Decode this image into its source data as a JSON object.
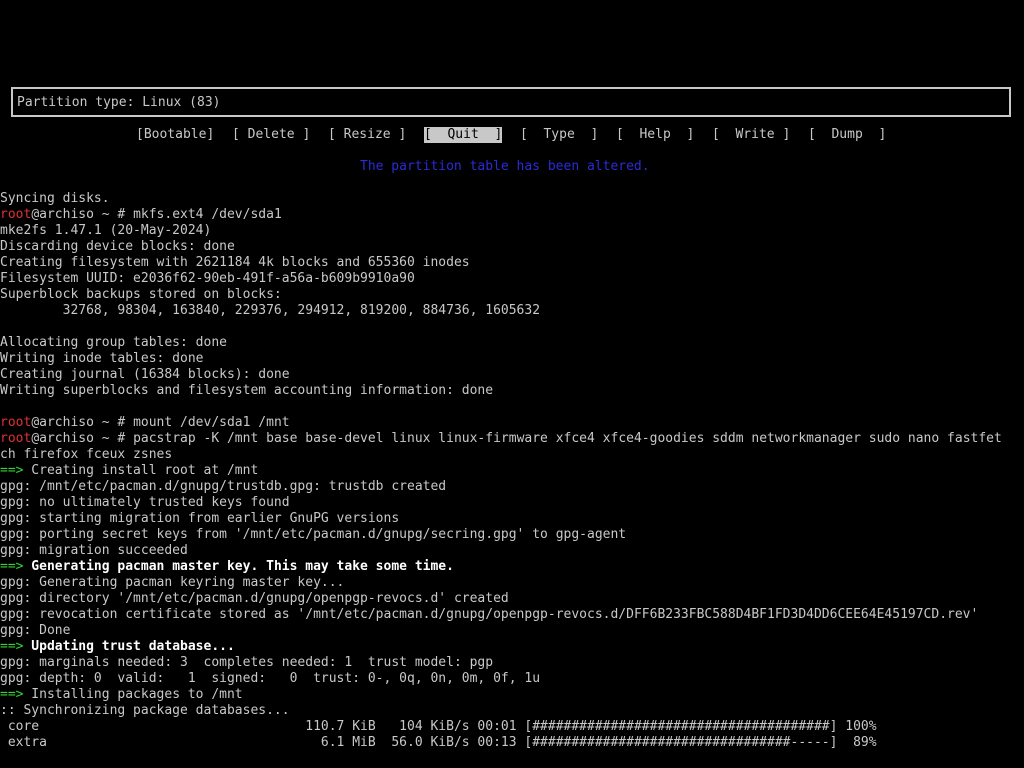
{
  "cfdisk": {
    "partition_type": "Partition type: Linux (83)",
    "menu": [
      {
        "label": "[Bootable]",
        "selected": false
      },
      {
        "label": "[ Delete ]",
        "selected": false
      },
      {
        "label": "[ Resize ]",
        "selected": false
      },
      {
        "label": "[  Quit  ]",
        "selected": true
      },
      {
        "label": "[  Type  ]",
        "selected": false
      },
      {
        "label": "[  Help  ]",
        "selected": false
      },
      {
        "label": "[  Write ]",
        "selected": false
      },
      {
        "label": "[  Dump  ]",
        "selected": false
      }
    ],
    "status": "The partition table has been altered."
  },
  "prompt": {
    "user": "root",
    "host_path": "@archiso ~ # "
  },
  "terminal": {
    "syncing": "Syncing disks.",
    "cmd_mkfs": "mkfs.ext4 /dev/sda1",
    "mkfs_out": [
      "mke2fs 1.47.1 (20-May-2024)",
      "Discarding device blocks: done",
      "Creating filesystem with 2621184 4k blocks and 655360 inodes",
      "Filesystem UUID: e2036f62-90eb-491f-a56a-b609b9910a90",
      "Superblock backups stored on blocks:",
      "        32768, 98304, 163840, 229376, 294912, 819200, 884736, 1605632",
      "",
      "Allocating group tables: done",
      "Writing inode tables: done",
      "Creating journal (16384 blocks): done",
      "Writing superblocks and filesystem accounting information: done",
      ""
    ],
    "cmd_mount": "mount /dev/sda1 /mnt",
    "cmd_pacstrap": "pacstrap -K /mnt base base-devel linux linux-firmware xfce4 xfce4-goodies sddm networkmanager sudo nano fastfet",
    "cmd_pacstrap_wrap": "ch firefox fceux zsnes",
    "arrow": "==>",
    "install_root": " Creating install root at /mnt",
    "gpg_lines_1": [
      "gpg: /mnt/etc/pacman.d/gnupg/trustdb.gpg: trustdb created",
      "gpg: no ultimately trusted keys found",
      "gpg: starting migration from earlier GnuPG versions",
      "gpg: porting secret keys from '/mnt/etc/pacman.d/gnupg/secring.gpg' to gpg-agent",
      "gpg: migration succeeded"
    ],
    "gen_master": " Generating pacman master key. This may take some time.",
    "gpg_lines_2": [
      "gpg: Generating pacman keyring master key...",
      "gpg: directory '/mnt/etc/pacman.d/gnupg/openpgp-revocs.d' created",
      "gpg: revocation certificate stored as '/mnt/etc/pacman.d/gnupg/openpgp-revocs.d/DFF6B233FBC588D4BF1FD3D4DD6CEE64E45197CD.rev'",
      "gpg: Done"
    ],
    "update_trust": " Updating trust database...",
    "gpg_lines_3": [
      "gpg: marginals needed: 3  completes needed: 1  trust model: pgp",
      "gpg: depth: 0  valid:   1  signed:   0  trust: 0-, 0q, 0n, 0m, 0f, 1u"
    ],
    "install_pkgs": " Installing packages to /mnt",
    "sync_db": ":: Synchronizing package databases...",
    "downloads": [
      " core                                  110.7 KiB   104 KiB/s 00:01 [######################################] 100%",
      " extra                                   6.1 MiB  56.0 KiB/s 00:13 [#################################-----]  89%"
    ]
  }
}
